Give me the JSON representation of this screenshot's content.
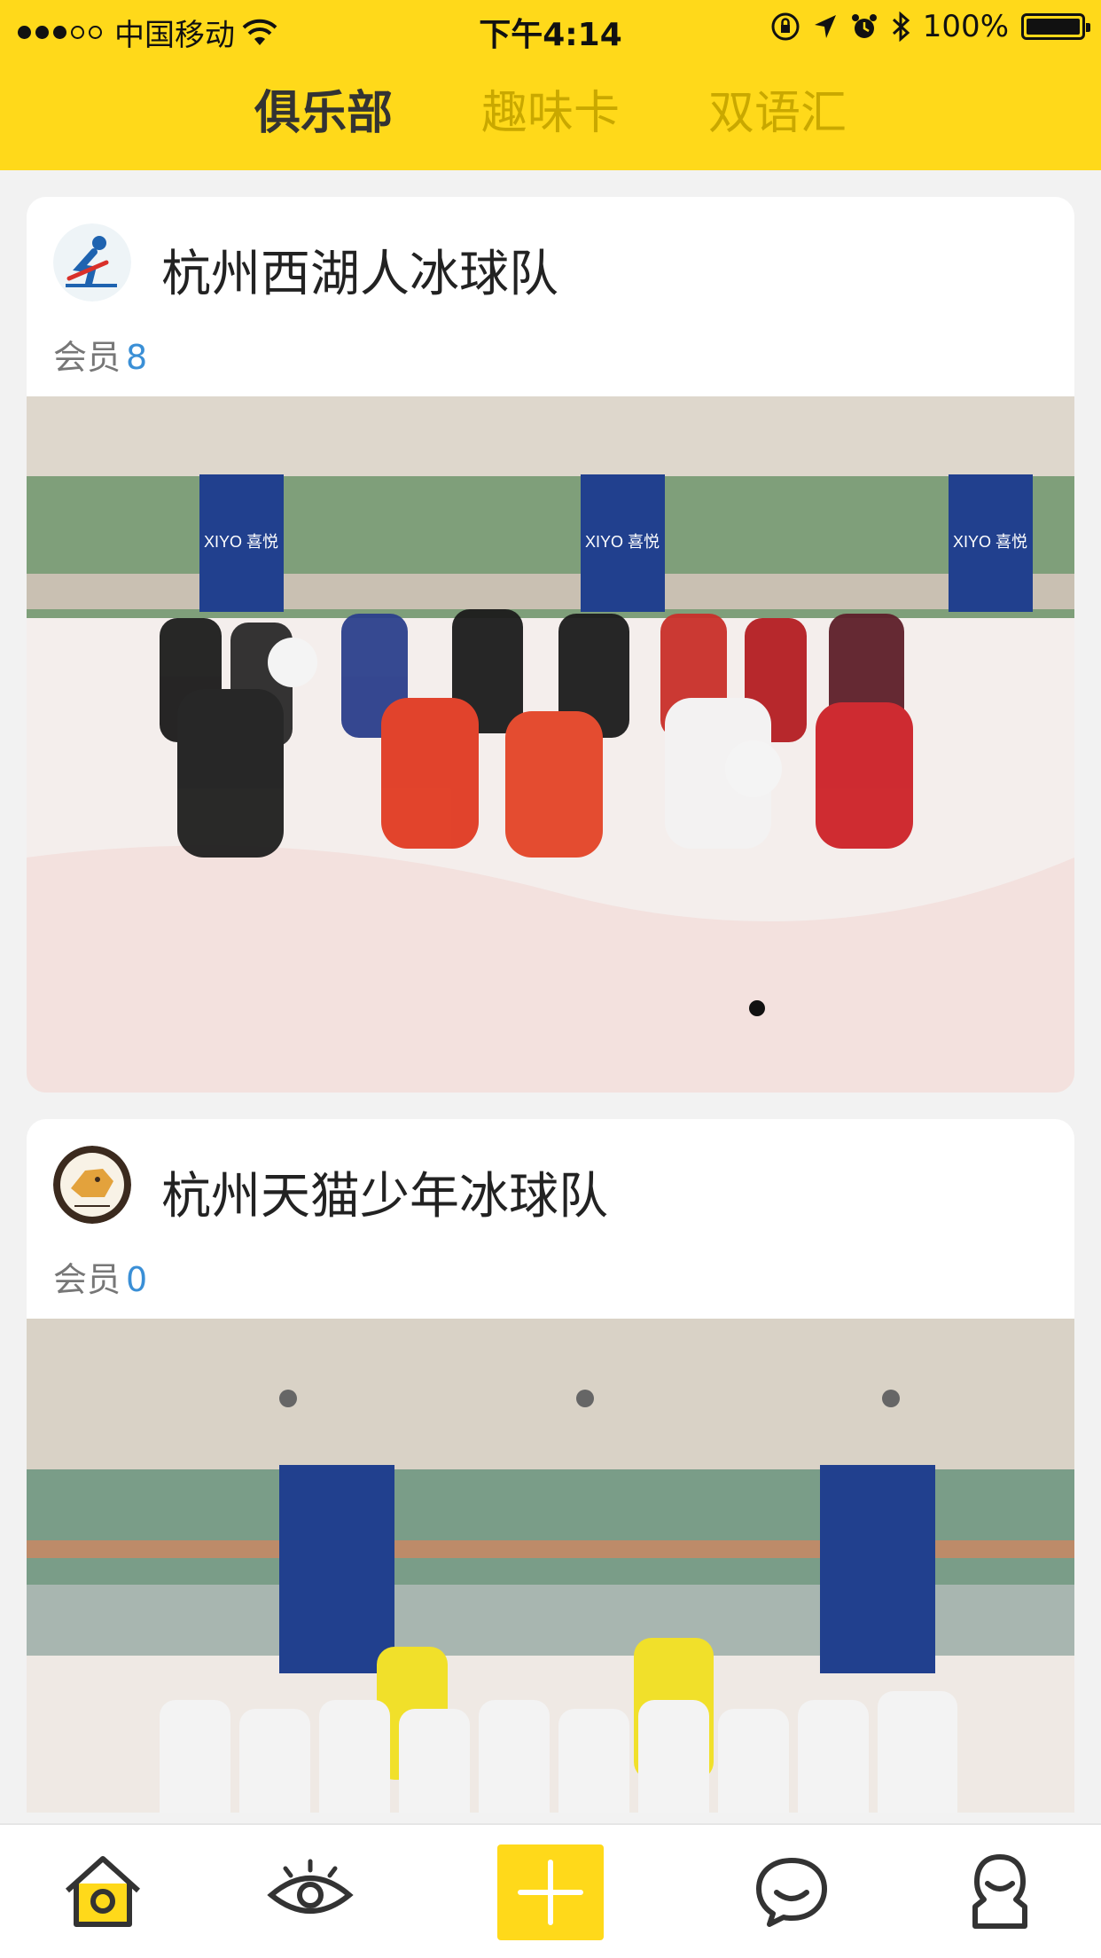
{
  "status_bar": {
    "carrier": "中国移动",
    "time": "下午4:14",
    "battery": "100%",
    "icons": [
      "signal-dots",
      "wifi-icon",
      "orientation-lock-icon",
      "location-icon",
      "alarm-icon",
      "bluetooth-icon",
      "battery-icon"
    ]
  },
  "tabs": [
    {
      "label": "俱乐部",
      "active": true
    },
    {
      "label": "趣味卡",
      "active": false
    },
    {
      "label": "双语汇",
      "active": false
    }
  ],
  "clubs": [
    {
      "name": "杭州西湖人冰球队",
      "members_label": "会员",
      "members_count": "8",
      "avatar_icon": "hockey-player-logo"
    },
    {
      "name": "杭州天猫少年冰球队",
      "members_label": "会员",
      "members_count": "0",
      "avatar_icon": "cat-team-logo"
    }
  ],
  "photo_banners": [
    "XIYO 喜悦",
    "XIYO 喜悦",
    "XIYO 喜悦"
  ],
  "bottom_nav": [
    "home-icon",
    "eye-icon",
    "add-icon",
    "chat-icon",
    "profile-icon"
  ],
  "colors": {
    "accent": "#ffd91a",
    "link": "#3a8fd6",
    "nav_icon": "#333333"
  }
}
